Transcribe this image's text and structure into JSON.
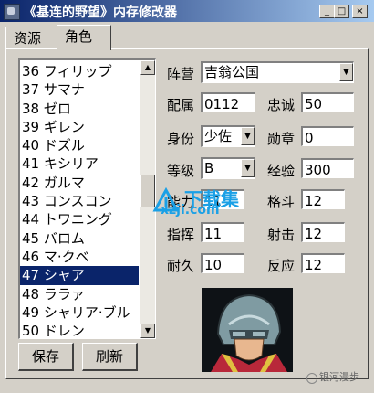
{
  "window": {
    "title": "《基连的野望》内存修改器",
    "minimize_label": "_",
    "maximize_label": "□",
    "close_label": "×"
  },
  "tabs": [
    {
      "label": "资源",
      "active": false
    },
    {
      "label": "角色",
      "active": true
    }
  ],
  "character_list": {
    "items": [
      "36 フィリップ",
      "37 サマナ",
      "38 ゼロ",
      "39 ギレン",
      "40 ドズル",
      "41 キシリア",
      "42 ガルマ",
      "43 コンスコン",
      "44 トワニング",
      "45 バロム",
      "46 マ·クベ",
      "47 シャア",
      "48 ララァ",
      "49 シャリア·ブル",
      "50 ドレン"
    ],
    "selected": "47 シャア"
  },
  "buttons": {
    "save": "保存",
    "refresh": "刷新"
  },
  "fields": {
    "faction_label": "阵营",
    "faction_value": "吉翁公国",
    "affiliation_label": "配属",
    "affiliation_value": "0112",
    "loyalty_label": "忠诚",
    "loyalty_value": "50",
    "rank_label": "身份",
    "rank_value": "少佐",
    "medal_label": "勋章",
    "medal_value": "0",
    "grade_label": "等级",
    "grade_value": "B",
    "experience_label": "经验",
    "experience_value": "300",
    "ability_label": "能力",
    "ability_value": "11",
    "melee_label": "格斗",
    "melee_value": "12",
    "command_label": "指挥",
    "command_value": "11",
    "shooting_label": "射击",
    "shooting_value": "12",
    "endurance_label": "耐久",
    "endurance_value": "10",
    "reaction_label": "反应",
    "reaction_value": "12"
  },
  "watermark": {
    "site_name": "下载集",
    "site_url": "xzji.com",
    "corner_text": "银河漫步"
  },
  "colors": {
    "selection": "#0a246a",
    "face": "#d4d0c8",
    "watermark": "#1aa0e6"
  }
}
